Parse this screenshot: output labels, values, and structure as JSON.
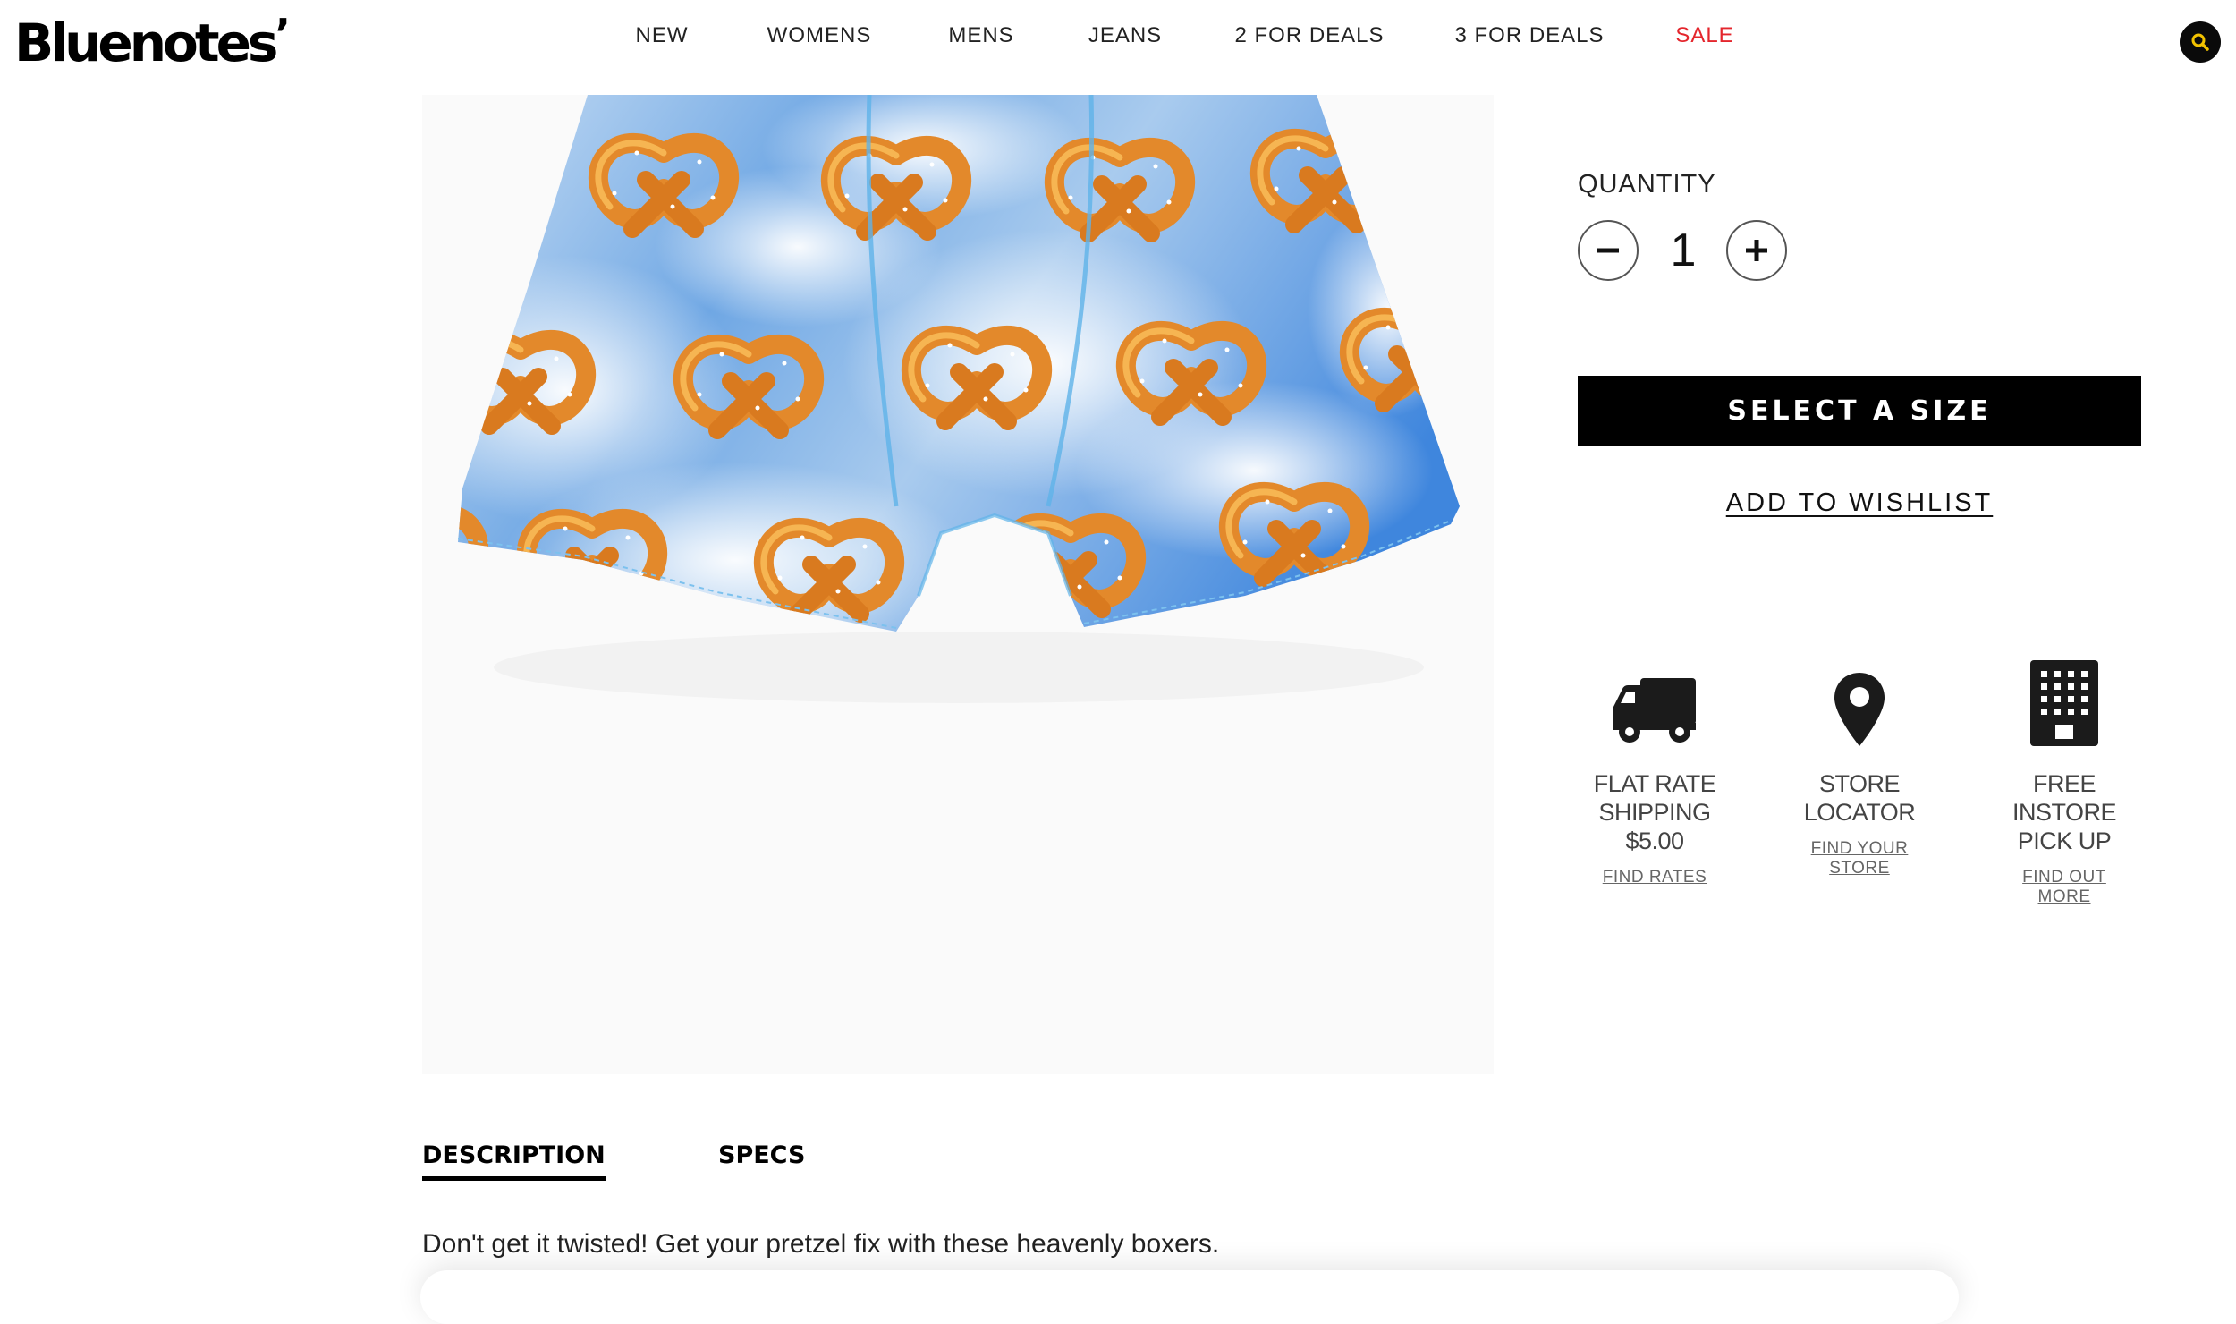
{
  "header": {
    "logo_text": "Bluenotes",
    "logo_mark": "’",
    "nav": [
      {
        "label": "NEW"
      },
      {
        "label": "WOMENS"
      },
      {
        "label": "MENS"
      },
      {
        "label": "JEANS"
      },
      {
        "label": "2 FOR DEALS"
      },
      {
        "label": "3 FOR DEALS"
      },
      {
        "label": "SALE",
        "color": "#e4262d"
      }
    ],
    "search_icon": "search-icon",
    "search_icon_color": "#f2c200"
  },
  "product": {
    "image": "pretzel-print-boxer-shorts-on-blue-sky-clouds",
    "quantity_label": "QUANTITY",
    "quantity": "1",
    "minus_icon": "minus-icon",
    "plus_icon": "plus-icon",
    "select_size_label": "SELECT A SIZE",
    "wishlist_label": "ADD TO WISHLIST"
  },
  "features": [
    {
      "icon": "truck-icon",
      "title": [
        "FLAT RATE",
        "SHIPPING",
        "$5.00"
      ],
      "link": "FIND RATES"
    },
    {
      "icon": "map-pin-icon",
      "title": [
        "STORE",
        "LOCATOR"
      ],
      "link": "FIND YOUR STORE"
    },
    {
      "icon": "building-icon",
      "title": [
        "FREE",
        "INSTORE",
        "PICK UP"
      ],
      "link": "FIND OUT MORE"
    }
  ],
  "tabs": [
    {
      "label": "DESCRIPTION",
      "active": true
    },
    {
      "label": "SPECS",
      "active": false
    }
  ],
  "description": "Don't get it twisted! Get your pretzel fix with these heavenly boxers."
}
